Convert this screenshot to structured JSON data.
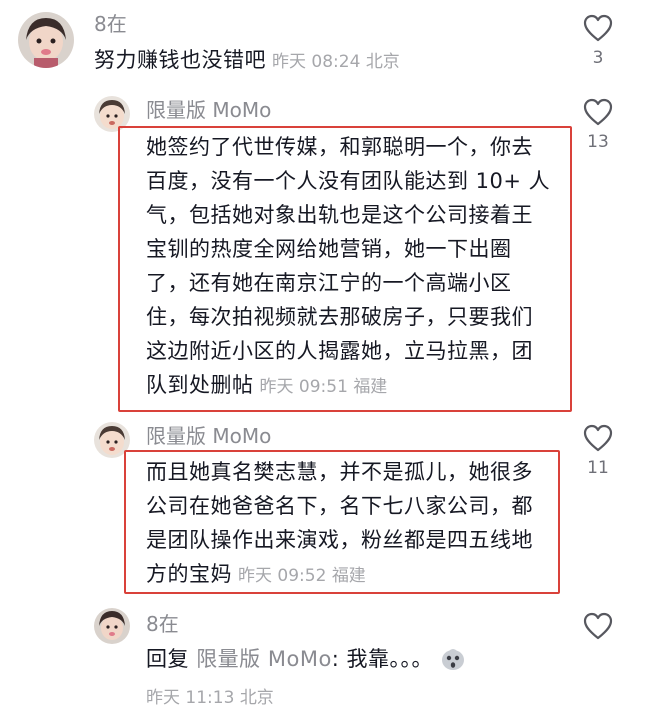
{
  "comments": [
    {
      "user": "8在",
      "text": "努力赚钱也没错吧",
      "time": "昨天 08:24",
      "location": "北京",
      "likes": "3",
      "avatar_icon": "girl-avatar-icon"
    },
    {
      "user": "限量版 MoMo",
      "text": "她签约了代世传媒，和郭聪明一个，你去百度，没有一个人没有团队能达到10+人气，包括她对象出轨也是这个公司接着王宝钏的热度全网给她营销，她一下出圈了，还有她在南京江宁的一个高端小区住，每次拍视频就去那破房子，只要我们这边附近小区的人揭露她，立马拉黑，团队到处删帖",
      "lines": [
        "她签约了代世传媒，和郭聪明一个，你去",
        "百度，没有一个人没有团队能达到 10+ 人",
        "气，包括她对象出轨也是这个公司接着王",
        "宝钏的热度全网给她营销，她一下出圈",
        "了，还有她在南京江宁的一个高端小区",
        "住，每次拍视频就去那破房子，只要我们",
        "这边附近小区的人揭露她，立马拉黑，团",
        "队到处删帖"
      ],
      "time": "昨天 09:51",
      "location": "福建",
      "likes": "13",
      "avatar_icon": "child-avatar-icon"
    },
    {
      "user": "限量版 MoMo",
      "lines": [
        "而且她真名樊志慧，并不是孤儿，她很多",
        "公司在她爸爸名下，名下七八家公司，都",
        "是团队操作出来演戏，粉丝都是四五线地",
        "方的宝妈"
      ],
      "time": "昨天 09:52",
      "location": "福建",
      "likes": "11",
      "avatar_icon": "child-avatar-icon"
    },
    {
      "user": "8在",
      "reply_prefix": "回复",
      "reply_to": "限量版 MoMo",
      "reply_text": ": 我靠。。。",
      "time": "昨天 11:13",
      "location": "北京",
      "avatar_icon": "girl-avatar-icon",
      "emoji_icon": "shocked-emoji-icon"
    }
  ],
  "colors": {
    "highlight": "#d9413a",
    "muted": "#8a8b91",
    "text": "#161823"
  }
}
